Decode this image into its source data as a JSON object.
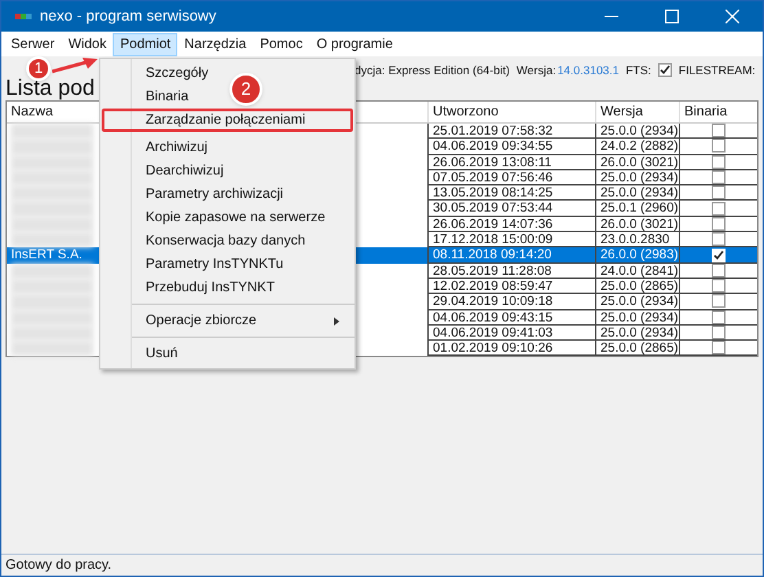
{
  "window": {
    "title": "nexo - program serwisowy"
  },
  "menu_bar": [
    {
      "label": "Serwer",
      "selected": false
    },
    {
      "label": "Widok",
      "selected": false
    },
    {
      "label": "Podmiot",
      "selected": true
    },
    {
      "label": "Narzędzia",
      "selected": false
    },
    {
      "label": "Pomoc",
      "selected": false
    },
    {
      "label": "O programie",
      "selected": false
    }
  ],
  "heading": "Lista pod",
  "server_info": {
    "edition": "dycja: Express Edition (64-bit)",
    "version_label": "Wersja:",
    "version": "14.0.3103.1",
    "fts_label": "FTS:",
    "fts_checked": true,
    "filestream_label": "FILESTREAM:"
  },
  "table": {
    "columns": [
      "Nazwa",
      "Utworzono",
      "Wersja",
      "Binaria"
    ],
    "rows": [
      {
        "name": "",
        "created": "25.01.2019 07:58:32",
        "version": "25.0.0 (2934)",
        "binaries": false,
        "selected": false
      },
      {
        "name": "",
        "created": "04.06.2019 09:34:55",
        "version": "24.0.2 (2882)",
        "binaries": false,
        "selected": false
      },
      {
        "name": "",
        "created": "26.06.2019 13:08:11",
        "version": "26.0.0 (3021)",
        "binaries": false,
        "selected": false
      },
      {
        "name": "",
        "created": "07.05.2019 07:56:46",
        "version": "25.0.0 (2934)",
        "binaries": false,
        "selected": false
      },
      {
        "name": "",
        "created": "13.05.2019 08:14:25",
        "version": "25.0.0 (2934)",
        "binaries": false,
        "selected": false
      },
      {
        "name": "",
        "created": "30.05.2019 07:53:44",
        "version": "25.0.1 (2960)",
        "binaries": false,
        "selected": false
      },
      {
        "name": "",
        "created": "26.06.2019 14:07:36",
        "version": "26.0.0 (3021)",
        "binaries": false,
        "selected": false
      },
      {
        "name": "",
        "created": "17.12.2018 15:00:09",
        "version": "23.0.0.2830",
        "binaries": false,
        "selected": false
      },
      {
        "name": "InsERT S.A.",
        "created": "08.11.2018 09:14:20",
        "version": "26.0.0 (2983)",
        "binaries": true,
        "selected": true
      },
      {
        "name": "",
        "created": "28.05.2019 11:28:08",
        "version": "24.0.0 (2841)",
        "binaries": false,
        "selected": false
      },
      {
        "name": "",
        "created": "12.02.2019 08:59:47",
        "version": "25.0.0 (2865)",
        "binaries": false,
        "selected": false
      },
      {
        "name": "",
        "created": "29.04.2019 10:09:18",
        "version": "25.0.0 (2934)",
        "binaries": false,
        "selected": false
      },
      {
        "name": "",
        "created": "04.06.2019 09:43:15",
        "version": "25.0.0 (2934)",
        "binaries": false,
        "selected": false
      },
      {
        "name": "",
        "created": "04.06.2019 09:41:03",
        "version": "25.0.0 (2934)",
        "binaries": false,
        "selected": false
      },
      {
        "name": "",
        "created": "01.02.2019 09:10:26",
        "version": "25.0.0 (2865)",
        "binaries": false,
        "selected": false
      }
    ]
  },
  "context_menu": [
    {
      "kind": "item",
      "label": "Szczegóły",
      "highlighted": false,
      "submenu": false
    },
    {
      "kind": "item",
      "label": "Binaria",
      "highlighted": false,
      "submenu": false
    },
    {
      "kind": "item",
      "label": "Zarządzanie połączeniami",
      "highlighted": true,
      "submenu": false
    },
    {
      "kind": "gap"
    },
    {
      "kind": "item",
      "label": "Archiwizuj",
      "highlighted": false,
      "submenu": false
    },
    {
      "kind": "item",
      "label": "Dearchiwizuj",
      "highlighted": false,
      "submenu": false
    },
    {
      "kind": "item",
      "label": "Parametry archiwizacji",
      "highlighted": false,
      "submenu": false
    },
    {
      "kind": "item",
      "label": "Kopie zapasowe na serwerze",
      "highlighted": false,
      "submenu": false
    },
    {
      "kind": "item",
      "label": "Konserwacja bazy danych",
      "highlighted": false,
      "submenu": false
    },
    {
      "kind": "item",
      "label": "Parametry InsTYNKTu",
      "highlighted": false,
      "submenu": false
    },
    {
      "kind": "item",
      "label": "Przebuduj InsTYNKT",
      "highlighted": false,
      "submenu": false
    },
    {
      "kind": "separator"
    },
    {
      "kind": "item",
      "label": "Operacje zbiorcze",
      "highlighted": false,
      "submenu": true
    },
    {
      "kind": "separator"
    },
    {
      "kind": "item",
      "label": "Usuń",
      "highlighted": false,
      "submenu": false
    }
  ],
  "callouts": [
    "1",
    "2"
  ],
  "status_bar": "Gotowy do pracy."
}
